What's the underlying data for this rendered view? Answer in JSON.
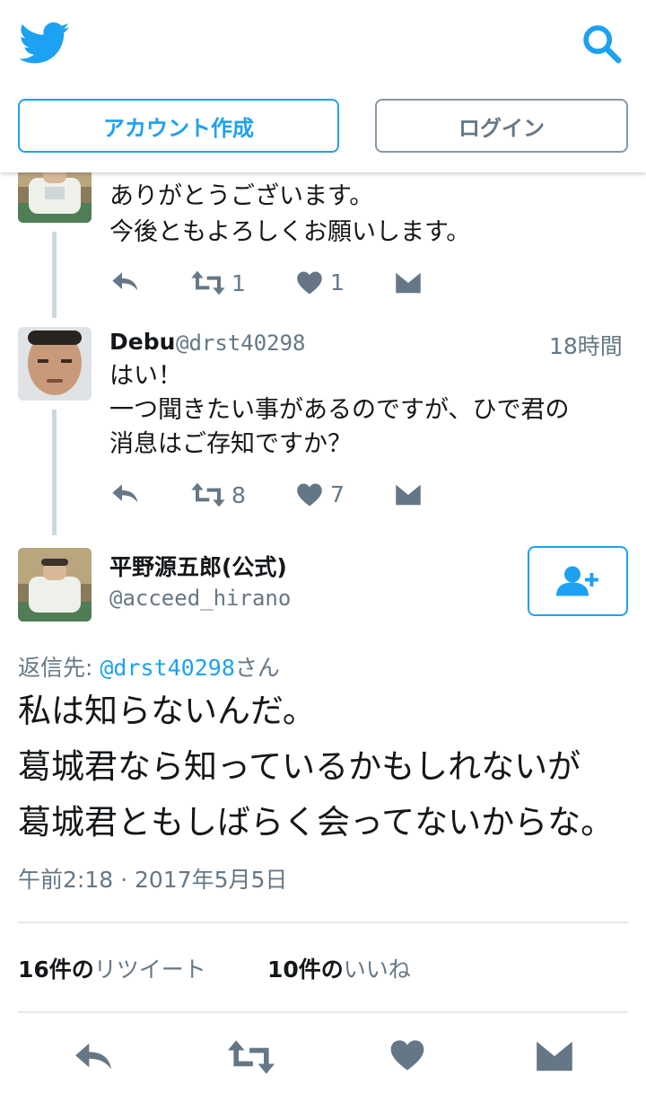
{
  "header": {
    "logo_icon": "twitter-bird-icon",
    "search_icon": "search-icon",
    "signup_label": "アカウント作成",
    "login_label": "ログイン",
    "brand_color": "#1da1f2"
  },
  "tweets": [
    {
      "text_line1": "ありがとうございます。",
      "text_line2": "今後ともよろしくお願いします。",
      "retweets": "1",
      "likes": "1"
    },
    {
      "name": "Debu",
      "handle": "@drst40298",
      "time": "18時間",
      "text_line1": "はい！",
      "text_line2": "一つ聞きたい事があるのですが、ひで君の",
      "text_line3": "消息はご存知ですか？",
      "retweets": "8",
      "likes": "7"
    }
  ],
  "main_tweet": {
    "name": "平野源五郎(公式)",
    "handle": "@acceed_hirano",
    "reply_prefix": "返信先: ",
    "reply_handle": "@drst40298",
    "reply_suffix": "さん",
    "line1": "私は知らないんだ。",
    "line2": "葛城君なら知っているかもしれないが",
    "line3": "葛城君ともしばらく会ってないからな。",
    "timestamp": "午前2:18 · 2017年5月5日",
    "retweet_count": "16件の",
    "retweet_label": "リツイート",
    "like_count": "10件の",
    "like_label": "いいね"
  }
}
